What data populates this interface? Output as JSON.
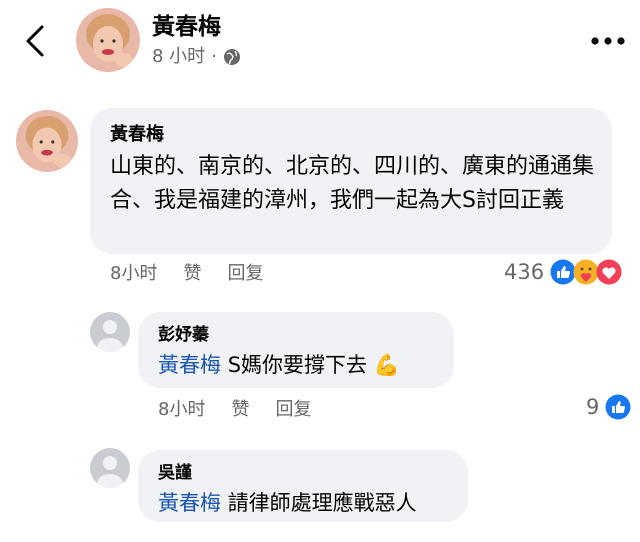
{
  "header": {
    "name": "黃春梅",
    "time": "8 小时",
    "dot": "·"
  },
  "post": {
    "author": "黃春梅",
    "text": "山東的、南京的、北京的、四川的、廣東的通通集合、我是福建的漳州，我們一起為大S討回正義",
    "time": "8小时",
    "like_label": "赞",
    "reply_label": "回复",
    "reaction_count": "436",
    "reactions": [
      "like-icon",
      "care-icon",
      "love-icon"
    ]
  },
  "replies": [
    {
      "author": "彭妤蓁",
      "mention": "黃春梅",
      "text": "S媽你要撐下去",
      "emoji": "💪",
      "time": "8小时",
      "like_label": "赞",
      "reply_label": "回复",
      "reaction_count": "9"
    },
    {
      "author": "吳謹",
      "mention": "黃春梅",
      "text": "請律師處理應戰惡人"
    }
  ],
  "colors": {
    "accent": "#1877f2",
    "bubble": "#f0f2f5",
    "mention": "#1a56b0",
    "secondary_text": "#65676b"
  }
}
